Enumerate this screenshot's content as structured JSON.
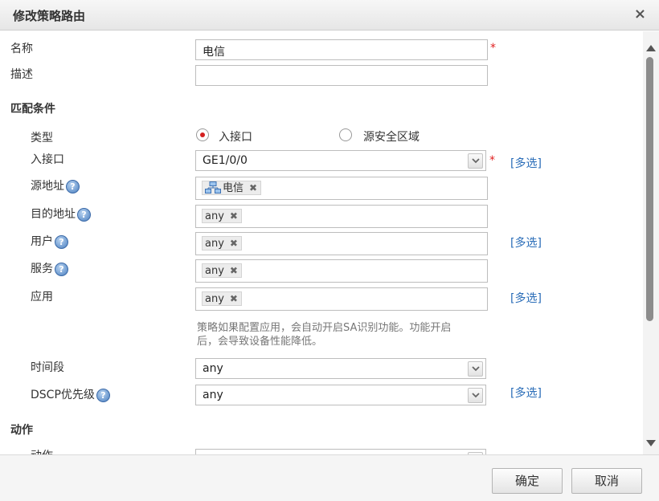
{
  "dialog": {
    "title": "修改策略路由",
    "close_glyph": "×"
  },
  "form": {
    "name": {
      "label": "名称",
      "value": "电信",
      "required_mark": "*"
    },
    "description": {
      "label": "描述",
      "value": ""
    },
    "match_section": "匹配条件",
    "type": {
      "label": "类型",
      "options": [
        "入接口",
        "源安全区域"
      ],
      "selected": "入接口"
    },
    "ingress_interface": {
      "label": "入接口",
      "value": "GE1/0/0",
      "required_mark": "*",
      "multi_label": "[多选]"
    },
    "source_address": {
      "label": "源地址",
      "tag": "电信",
      "tag_icon": "network-icon"
    },
    "destination_address": {
      "label": "目的地址",
      "tag": "any"
    },
    "user": {
      "label": "用户",
      "tag": "any",
      "multi_label": "[多选]"
    },
    "service": {
      "label": "服务",
      "tag": "any"
    },
    "application": {
      "label": "应用",
      "tag": "any",
      "multi_label": "[多选]"
    },
    "app_hint_line1": "策略如果配置应用，会自动开启SA识别功能。功能开启",
    "app_hint_line2": "后，会导致设备性能降低。",
    "time_range": {
      "label": "时间段",
      "value": "any"
    },
    "dscp": {
      "label": "DSCP优先级",
      "value": "any",
      "multi_label": "[多选]"
    },
    "action_section": "动作",
    "action": {
      "label": "动作"
    }
  },
  "help_glyph": "?",
  "tag_remove_glyph": "✖",
  "buttons": {
    "ok": "确定",
    "cancel": "取消"
  },
  "colors": {
    "link": "#2a6db8",
    "required": "#e02020",
    "radio_selected": "#d42020"
  }
}
